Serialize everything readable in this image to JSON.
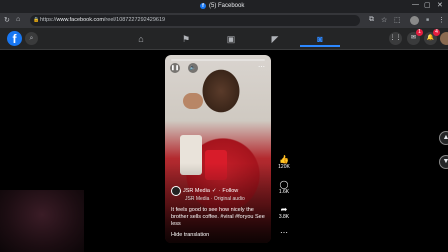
{
  "browser": {
    "tab_title": "(5) Facebook",
    "url_prefix": "https://",
    "url_domain": "www.facebook.com",
    "url_path": "/reel/1087227292429619"
  },
  "facebook": {
    "logo": "f",
    "notifications": {
      "messenger": "1",
      "bell": "4"
    }
  },
  "reel": {
    "author": "JSR Media",
    "follow": "Follow",
    "audio": "JSR Media · Original audio",
    "caption": "It feels good to see how nicely the brother sells coffee. #viral #foryou See less",
    "hide_translation": "Hide translation",
    "likes": "120K",
    "comments": "1.6K",
    "shares": "3.8K"
  },
  "icons": [
    "facebook-icon",
    "search-icon",
    "home-icon",
    "flag-icon",
    "store-icon",
    "megaphone-icon",
    "gaming-icon",
    "grid-icon",
    "messenger-icon",
    "bell-icon",
    "pause-icon",
    "volume-icon",
    "like-icon",
    "comment-icon",
    "share-icon",
    "more-icon",
    "arrow-up-icon",
    "arrow-down-icon"
  ],
  "colors": {
    "accent": "#1877f2",
    "badge": "#e41e3f",
    "background": "#000000"
  }
}
